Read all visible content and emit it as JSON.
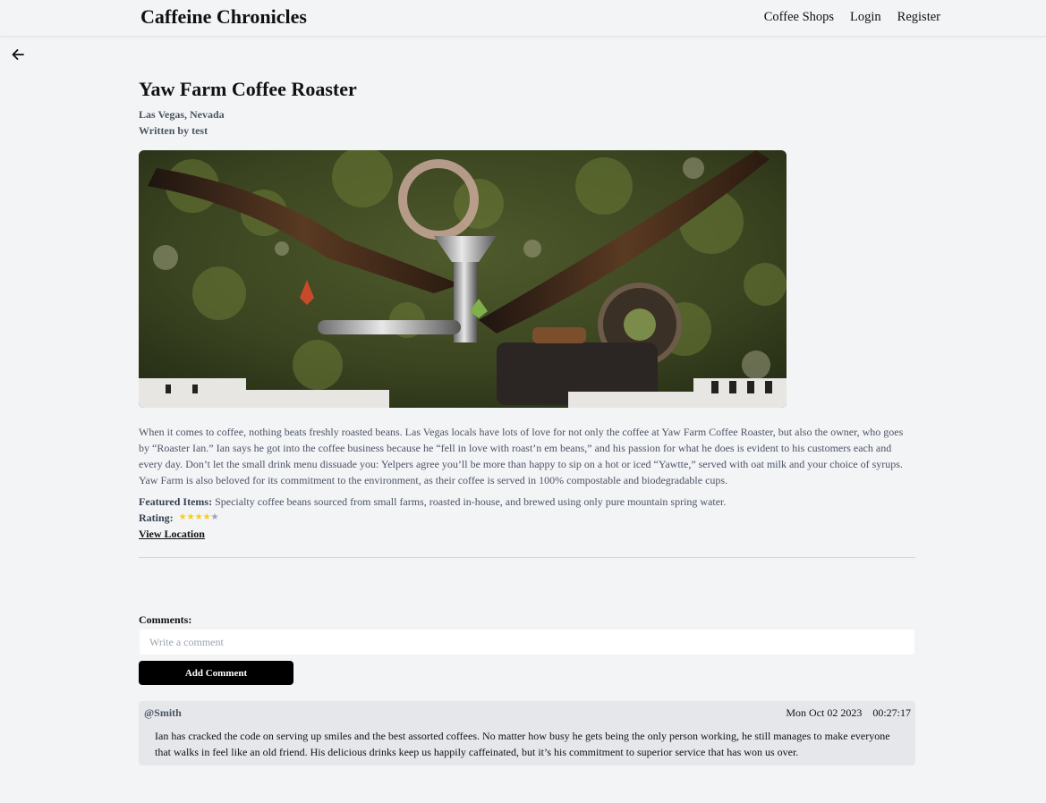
{
  "nav": {
    "brand": "Caffeine Chronicles",
    "links": [
      "Coffee Shops",
      "Login",
      "Register"
    ]
  },
  "post": {
    "title": "Yaw Farm Coffee Roaster",
    "location": "Las Vegas, Nevada",
    "author": "Written by test",
    "description": "When it comes to coffee, nothing beats freshly roasted beans. Las Vegas locals have lots of love for not only the coffee at Yaw Farm Coffee Roaster, but also the owner, who goes by “Roaster Ian.” Ian says he got into the coffee business because he “fell in love with roast’n em beans,” and his passion for what he does is evident to his customers each and every day. Don’t let the small drink menu dissuade you: Yelpers agree you’ll be more than happy to sip on a hot or iced “Yawtte,” served with oat milk and your choice of syrups. Yaw Farm is also beloved for its commitment to the environment, as their coffee is served in 100% compostable and biodegradable cups.",
    "featured_label": "Featured Items:",
    "featured_text": " Specialty coffee beans sourced from small farms, roasted in-house, and brewed using only pure mountain spring water.",
    "rating_label": "Rating:",
    "rating_value": 4,
    "rating_max": 5,
    "view_location": "View Location"
  },
  "comments": {
    "label": "Comments:",
    "placeholder": "Write a comment",
    "button": "Add Comment",
    "items": [
      {
        "user": "@Smith",
        "date": "Mon Oct 02 2023",
        "time": "00:27:17",
        "text": "Ian has cracked the code on serving up smiles and the best assorted coffees. No matter how busy he gets being the only person working, he still manages to make everyone that walks in feel like an old friend. His delicious drinks keep us happily caffeinated, but it’s his commitment to superior service that has won us over."
      }
    ]
  },
  "colors": {
    "accent": "#000000",
    "star_on": "#facc15",
    "star_off": "#9ca3af",
    "background": "#f3f4f6"
  },
  "icons": {
    "back": "arrow-left-icon"
  }
}
